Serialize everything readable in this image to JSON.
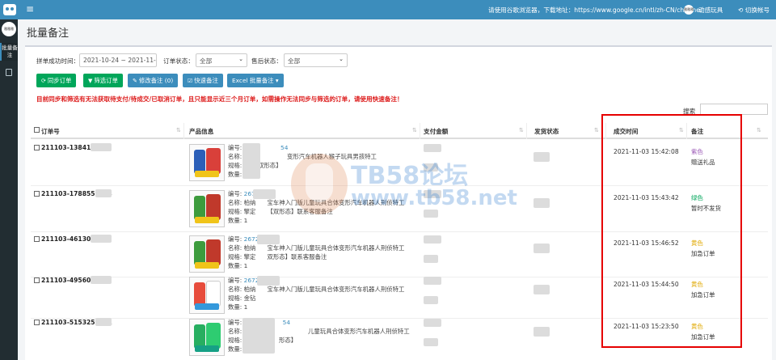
{
  "topbar": {
    "notice": "请使用谷歌浏览器，下载地址：https://www.google.cn/intl/zh-CN/chrome/",
    "avatar_text": "雅雅雅",
    "user": "动感玩具",
    "switch_account": "切换帐号"
  },
  "sidebar": {
    "avatar_text": "雅雅雅",
    "active_item": "批量备注"
  },
  "page": {
    "title": "批量备注"
  },
  "filters": {
    "date_label": "拼单成功时间：",
    "date_value": "2021-10-24 ~ 2021-11-05",
    "order_status_label": "订单状态：",
    "order_status_value": "全部",
    "after_sale_label": "售后状态：",
    "after_sale_value": "全部"
  },
  "buttons": {
    "sync": "同步订单",
    "filter": "筛选订单",
    "edit_note": "修改备注 (0)",
    "quick_note": "快速备注",
    "excel": "Excel 批量备注"
  },
  "warning": "目前同步和筛选有无法获取待支付/待成交/已取消订单，且只能显示近三个月订单，如需操作无法同步与筛选的订单，请使用快速备注！",
  "search": {
    "label": "搜索"
  },
  "table": {
    "headers": [
      "订单号",
      "产品信息",
      "支付金额",
      "发货状态",
      "成交时间",
      "备注"
    ],
    "rows": [
      {
        "order": "211103-13841726",
        "code": "26",
        "code_tail": "54",
        "name": "名称: 柏",
        "name_tail": "变形汽车机器人猴子玩具男孩特工",
        "spec": "规格: 极",
        "spec_tail": "双形态】",
        "qty": "数量: 1",
        "time": "2021-11-03 15:42:08",
        "color_label": "紫色",
        "color_hex": "#9b59b6",
        "note": "赠送礼品"
      },
      {
        "order": "211103-1788556278",
        "code": "267",
        "code_tail": "",
        "name": "名称: 柏纳",
        "name_tail": "宝车神入门版儿童玩具合体变形汽车机器人刑侦特工",
        "spec": "规格: 擎定",
        "spec_tail": "【双形态】联系客服备注",
        "qty": "数量: 1",
        "time": "2021-11-03 15:43:42",
        "color_label": "绿色",
        "color_hex": "#00a65a",
        "note": "暂时不发货"
      },
      {
        "order": "211103-461301431",
        "code": "2672",
        "code_tail": "",
        "name": "名称: 柏纳",
        "name_tail": "宝车神入门版儿童玩具合体变形汽车机器人刑侦特工",
        "spec": "规格: 擎定",
        "spec_tail": "双形态】联系客服备注",
        "qty": "数量: 1",
        "time": "2021-11-03 15:46:52",
        "color_label": "黄色",
        "color_hex": "#e0a800",
        "note": "加急订单"
      },
      {
        "order": "211103-49560952",
        "code": "2672",
        "code_tail": "",
        "name": "名称: 柏纳",
        "name_tail": "宝车神入门版儿童玩具合体变形汽车机器人刑侦特工",
        "spec": "规格: 金钻",
        "spec_tail": "",
        "qty": "数量: 1",
        "time": "2021-11-03 15:44:50",
        "color_label": "黄色",
        "color_hex": "#e0a800",
        "note": "加急订单"
      },
      {
        "order": "211103-5153253671",
        "code": "",
        "code_tail": "54",
        "name": "名称: 柏",
        "name_tail": "儿童玩具合体变形汽车机器人刑侦特工",
        "spec": "规格: 鳄",
        "spec_tail": "形态】",
        "qty": "数量: 1",
        "time": "2021-11-03 15:23:50",
        "color_label": "黄色",
        "color_hex": "#e0a800",
        "note": "加急订单"
      }
    ]
  },
  "watermark": {
    "line1": "TB58论坛",
    "line2": "www.tb58.net"
  }
}
